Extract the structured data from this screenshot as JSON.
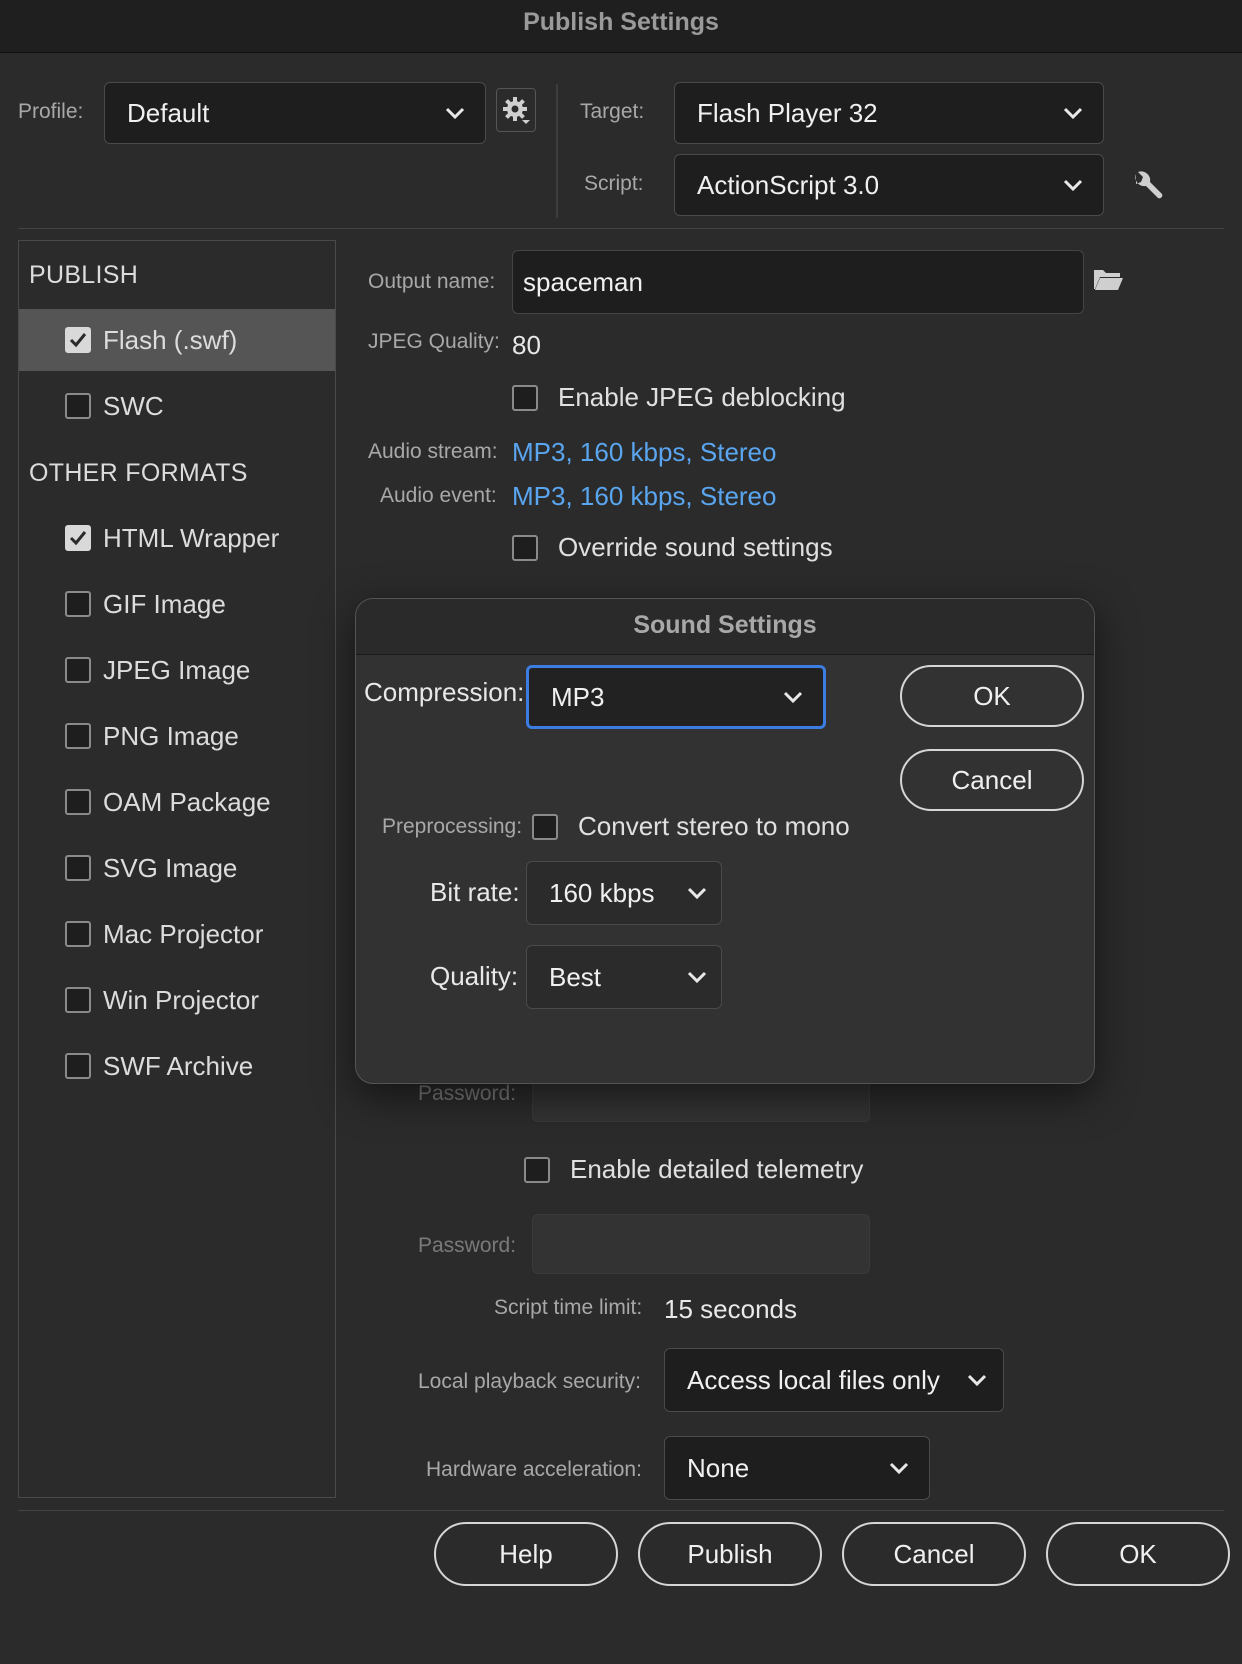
{
  "window": {
    "title": "Publish Settings"
  },
  "header": {
    "profile_label": "Profile:",
    "profile_value": "Default",
    "target_label": "Target:",
    "target_value": "Flash Player 32",
    "script_label": "Script:",
    "script_value": "ActionScript 3.0"
  },
  "sidebar": {
    "publish_heading": "PUBLISH",
    "publish_items": [
      {
        "label": "Flash (.swf)",
        "checked": true
      },
      {
        "label": "SWC",
        "checked": false
      }
    ],
    "other_heading": "OTHER FORMATS",
    "other_items": [
      {
        "label": "HTML Wrapper",
        "checked": true
      },
      {
        "label": "GIF Image",
        "checked": false
      },
      {
        "label": "JPEG Image",
        "checked": false
      },
      {
        "label": "PNG Image",
        "checked": false
      },
      {
        "label": "OAM Package",
        "checked": false
      },
      {
        "label": "SVG Image",
        "checked": false
      },
      {
        "label": "Mac Projector",
        "checked": false
      },
      {
        "label": "Win Projector",
        "checked": false
      },
      {
        "label": "SWF Archive",
        "checked": false
      }
    ]
  },
  "main": {
    "output_name_label": "Output name:",
    "output_name_value": "spaceman",
    "jpeg_quality_label": "JPEG Quality:",
    "jpeg_quality_value": "80",
    "jpeg_deblocking_label": "Enable JPEG deblocking",
    "audio_stream_label": "Audio stream:",
    "audio_stream_value": "MP3, 160 kbps, Stereo",
    "audio_event_label": "Audio event:",
    "audio_event_value": "MP3, 160 kbps, Stereo",
    "override_sound_label": "Override sound settings",
    "password1_label": "Password:",
    "telemetry_label": "Enable detailed telemetry",
    "password2_label": "Password:",
    "script_time_label": "Script time limit:",
    "script_time_value": "15 seconds",
    "local_security_label": "Local playback security:",
    "local_security_value": "Access local files only",
    "hw_accel_label": "Hardware acceleration:",
    "hw_accel_value": "None"
  },
  "sound_dialog": {
    "title": "Sound Settings",
    "compression_label": "Compression:",
    "compression_value": "MP3",
    "ok_label": "OK",
    "cancel_label": "Cancel",
    "preprocessing_label": "Preprocessing:",
    "convert_mono_label": "Convert stereo to mono",
    "bitrate_label": "Bit rate:",
    "bitrate_value": "160 kbps",
    "quality_label": "Quality:",
    "quality_value": "Best"
  },
  "footer": {
    "help_label": "Help",
    "publish_label": "Publish",
    "cancel_label": "Cancel",
    "ok_label": "OK"
  },
  "colors": {
    "link": "#5aa5ef",
    "focus_ring": "#3b7de0",
    "selected_row": "#555555"
  }
}
